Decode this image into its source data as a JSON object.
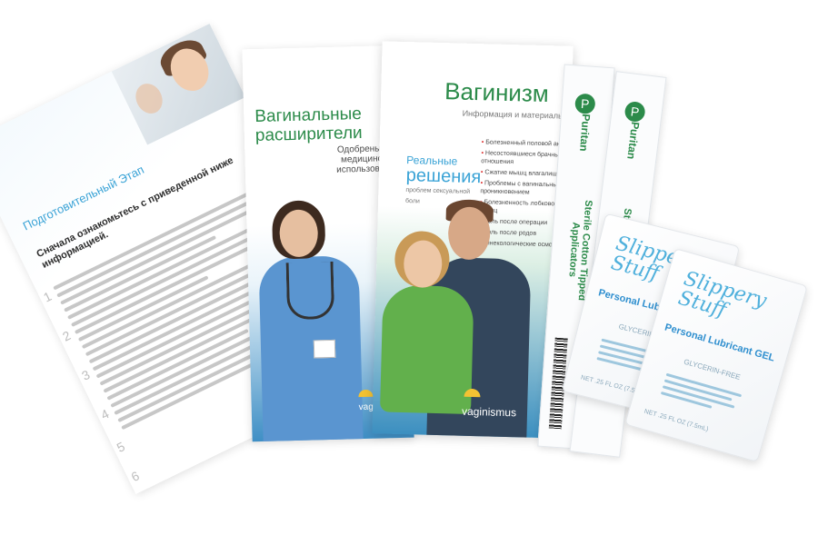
{
  "sheet": {
    "heading": "Подготовительный Этап",
    "intro": "Сначала ознакомьтесь с приведенной ниже информацией.",
    "step_numbers": [
      "1",
      "2",
      "3",
      "4",
      "5",
      "6"
    ]
  },
  "brochure_dilators": {
    "title": "Вагинальные расширители",
    "subtitle": "Одобрены для медицинского использования",
    "brand": "vaginismus"
  },
  "brochure_vaginismus": {
    "title": "Вагинизм",
    "subtitle": "Информация и материалы",
    "tagline_top": "Реальные",
    "tagline_main": "решения",
    "tagline_small": "проблем сексуальной боли",
    "list": [
      "Болезненный половой акт",
      "Несостоявшиеся брачные отношения",
      "Сжатие мышц влагалища",
      "Проблемы с вагинальным проникновением",
      "Болезненность лобкового мышц",
      "Боль после операции",
      "Боль после родов",
      "Гинекологические осмотры"
    ],
    "brand": "vaginismus"
  },
  "applicators": [
    {
      "brand": "Puritan",
      "label": "Sterile Cotton Tipped Applicators"
    },
    {
      "brand": "Puritan",
      "label": "Sterile Applicators"
    }
  ],
  "sachets": [
    {
      "brand": "Slippery Stuff",
      "product": "Personal Lubricant GEL",
      "note": "GLYCERIN-FREE",
      "net": "NET .25 FL OZ (7.5mL)"
    },
    {
      "brand": "Slippery Stuff",
      "product": "Personal Lubricant GEL",
      "note": "GLYCERIN-FREE",
      "net": "NET .25 FL OZ (7.5mL)"
    }
  ],
  "colors": {
    "brand_green": "#2c8b4a",
    "accent_blue": "#3aa3d6",
    "lube_blue": "#4fb0dc"
  }
}
